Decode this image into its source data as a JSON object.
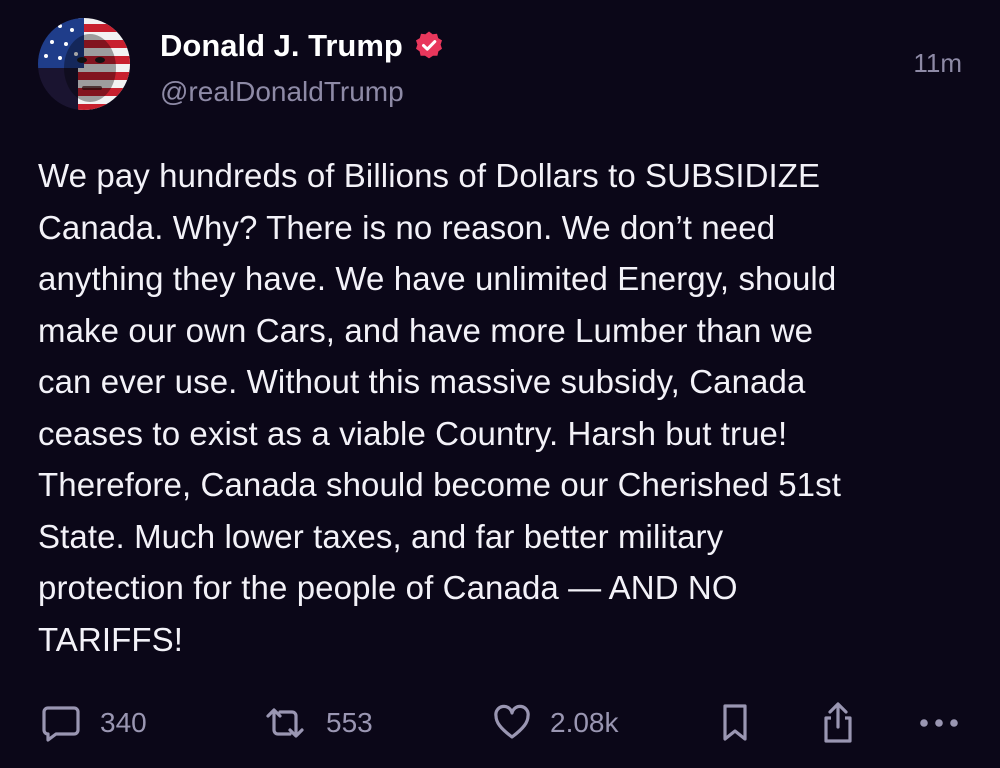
{
  "post": {
    "author": {
      "display_name": "Donald J. Trump",
      "handle": "@realDonaldTrump",
      "verified": true
    },
    "timestamp": "11m",
    "text_lines": [
      "We pay hundreds of Billions of Dollars to SUBSIDIZE",
      "Canada. Why? There is no reason. We don’t need",
      "anything they have. We have unlimited Energy, should",
      "make our own Cars, and have more Lumber than we",
      "can ever use. Without this massive subsidy, Canada",
      "ceases to exist as a viable Country. Harsh but true!",
      "Therefore, Canada should become our Cherished 51st",
      "State. Much lower taxes, and far better military",
      "protection for the people of Canada — AND NO",
      "TARIFFS!"
    ],
    "stats": {
      "replies": "340",
      "reposts": "553",
      "likes": "2.08k"
    }
  },
  "icons": {
    "reply": "speech-bubble-icon",
    "repost": "repost-arrows-icon",
    "like": "heart-icon",
    "bookmark": "bookmark-icon",
    "share": "share-icon",
    "more": "more-dots-icon",
    "verified": "verified-badge-icon"
  },
  "colors": {
    "background": "#0b0718",
    "text": "#f3f2f8",
    "muted": "#8e8aa6",
    "verified": "#e8375c"
  }
}
